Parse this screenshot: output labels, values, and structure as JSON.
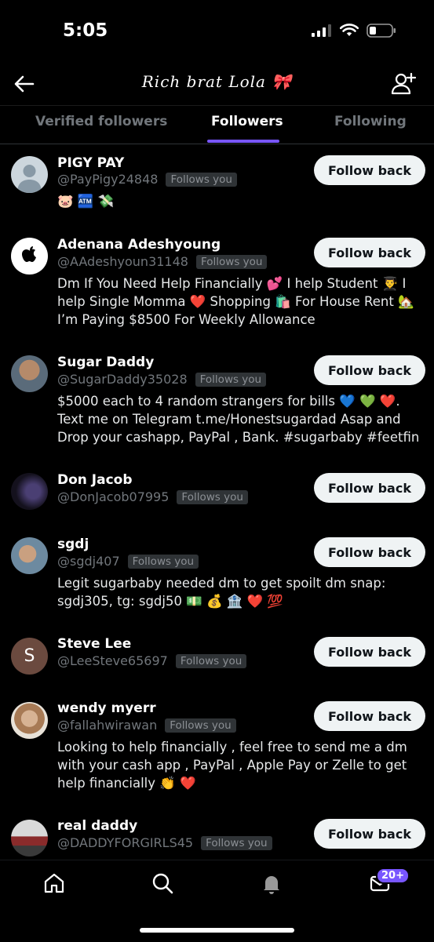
{
  "status_bar": {
    "time": "5:05"
  },
  "header": {
    "title": "Rich brat Lola 🎀"
  },
  "tabs": [
    {
      "label": "Verified followers"
    },
    {
      "label": "Followers"
    },
    {
      "label": "Following"
    }
  ],
  "follow_button_label": "Follow back",
  "follows_you_label": "Follows you",
  "followers": [
    {
      "name": "PIGY PAY",
      "handle": "@PayPigy24848",
      "bio": "🐷 🏧 💸"
    },
    {
      "name": "Adenana Adeshyoung",
      "handle": "@AAdeshyoun31148",
      "bio": "Dm If You Need Help Financially 💕 I help Student 👨‍🎓 I help Single Momma ❤️ Shopping 🛍️ For House Rent 🏡 I’m Paying $8500 For Weekly Allowance"
    },
    {
      "name": "Sugar Daddy",
      "handle": "@SugarDaddy35028",
      "bio": "$5000 each to 4 random strangers for bills 💙 💚 ❤️. Text me on Telegram t.me/Honestsugardad Asap and Drop your cashapp, PayPal , Bank. #sugarbaby #feetfin"
    },
    {
      "name": "Don Jacob",
      "handle": "@DonJacob07995",
      "bio": ""
    },
    {
      "name": "sgdj",
      "handle": "@sgdj407",
      "bio": "Legit sugarbaby needed dm to get spoilt dm snap: sgdj305, tg: sgdj50 💵 💰 🏦 ❤️ 💯"
    },
    {
      "name": "Steve Lee",
      "handle": "@LeeSteve65697",
      "bio": "",
      "avatar_letter": "S"
    },
    {
      "name": "wendy myerr",
      "handle": "@fallahwirawan",
      "bio": "Looking to help financially , feel free to send me a dm with your cash app , PayPal , Apple Pay or Zelle to get help financially 👏 ❤️"
    },
    {
      "name": "real daddy",
      "handle": "@DADDYFORGIRLS45",
      "bio": ""
    }
  ],
  "tab_bar": {
    "notification_badge": "20+"
  },
  "colors": {
    "accent": "#7856ff",
    "button_bg": "#eff3f4",
    "muted": "#71767b"
  }
}
